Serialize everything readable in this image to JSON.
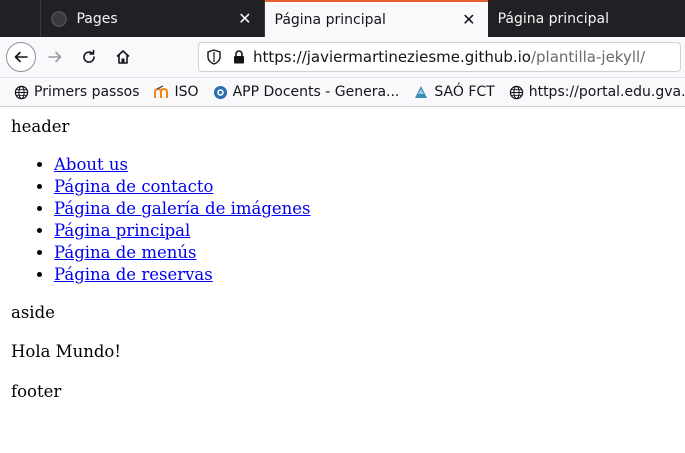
{
  "browser": {
    "tabs": [
      {
        "title": "Pages",
        "active": false
      },
      {
        "title": "Página principal",
        "active": true
      },
      {
        "title": "Página principal",
        "active": false
      }
    ],
    "url_domain": "https://javiermartineziesme.github.io",
    "url_path": "/plantilla-jekyll/",
    "bookmarks": [
      {
        "label": "Primers passos",
        "icon": "globe-icon"
      },
      {
        "label": "ISO",
        "icon": "moodle-icon"
      },
      {
        "label": "APP Docents - Genera...",
        "icon": "gva-icon"
      },
      {
        "label": "SAÓ FCT",
        "icon": "sao-icon"
      },
      {
        "label": "https://portal.edu.gva...",
        "icon": "globe-icon"
      }
    ]
  },
  "page": {
    "header": "header",
    "nav_links": [
      "About us",
      "Página de contacto",
      "Página de galería de imágenes",
      "Página principal",
      "Página de menús",
      "Página de reservas"
    ],
    "aside": "aside",
    "content": "Hola Mundo!",
    "footer": "footer"
  },
  "colors": {
    "tabbar_bg": "#202124",
    "active_tab_accent": "#e8612c",
    "link": "#0000ee"
  }
}
